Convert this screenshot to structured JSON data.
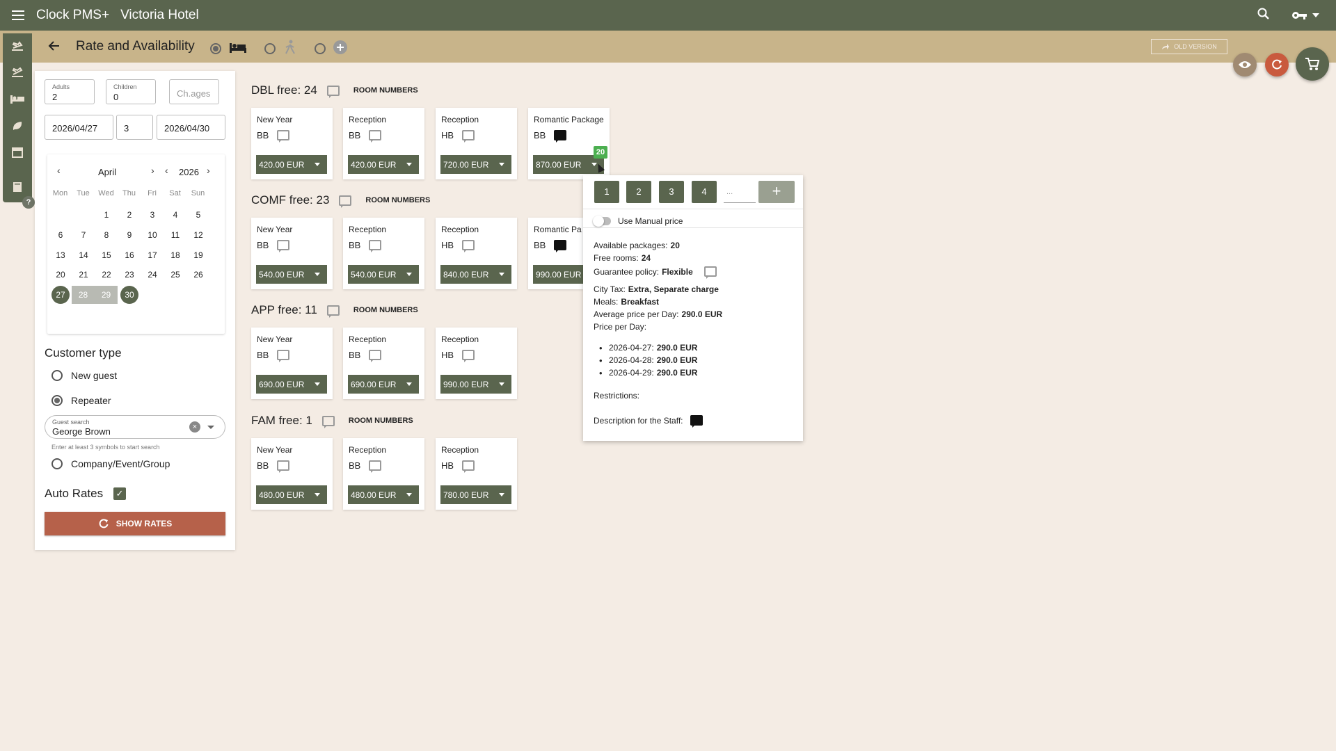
{
  "app": {
    "name": "Clock PMS+",
    "hotel": "Victoria Hotel"
  },
  "page": {
    "title": "Rate and Availability",
    "old_version": "OLD VERSION"
  },
  "icons": {
    "menu": "menu-icon",
    "search": "search-icon",
    "key": "key-icon",
    "eye": "eye-icon",
    "refresh": "refresh-icon",
    "cart": "cart-icon"
  },
  "colors": {
    "topbar": "#5a654e",
    "subbar": "#c8b48a",
    "accent": "#b6614a",
    "badge": "#4caf50"
  },
  "search": {
    "adults_label": "Adults",
    "adults": "2",
    "children_label": "Children",
    "children": "0",
    "ch_ages_placeholder": "Ch.ages",
    "date_from": "2026/04/27",
    "nights": "3",
    "date_to": "2026/04/30"
  },
  "calendar": {
    "month": "April",
    "year": "2026",
    "weekdays": [
      "Mon",
      "Tue",
      "Wed",
      "Thu",
      "Fri",
      "Sat",
      "Sun"
    ],
    "weeks": [
      [
        "",
        "",
        "1",
        "2",
        "3",
        "4",
        "5"
      ],
      [
        "6",
        "7",
        "8",
        "9",
        "10",
        "11",
        "12"
      ],
      [
        "13",
        "14",
        "15",
        "16",
        "17",
        "18",
        "19"
      ],
      [
        "20",
        "21",
        "22",
        "23",
        "24",
        "25",
        "26"
      ],
      [
        "27",
        "28",
        "29",
        "30",
        "",
        "",
        ""
      ]
    ],
    "selected": [
      "27",
      "30"
    ],
    "in_range": [
      "28",
      "29"
    ]
  },
  "customer": {
    "title": "Customer type",
    "options": [
      "New guest",
      "Repeater",
      "Company/Event/Group"
    ],
    "selected": "Repeater",
    "guest_search_label": "Guest search",
    "guest_value": "George Brown",
    "guest_hint": "Enter at least 3 symbols to start search"
  },
  "auto_rates": {
    "label": "Auto Rates",
    "checked": true
  },
  "show_rates": "SHOW RATES",
  "room_numbers_label": "ROOM NUMBERS",
  "rooms": [
    {
      "title": "DBL free: 24",
      "cards": [
        {
          "name": "New Year",
          "meal": "BB",
          "price": "420.00 EUR",
          "note": false
        },
        {
          "name": "Reception",
          "meal": "BB",
          "price": "420.00 EUR",
          "note": false
        },
        {
          "name": "Reception",
          "meal": "HB",
          "price": "720.00 EUR",
          "note": false
        },
        {
          "name": "Romantic Package",
          "meal": "BB",
          "price": "870.00 EUR",
          "note": true
        }
      ]
    },
    {
      "title": "COMF free: 23",
      "cards": [
        {
          "name": "New Year",
          "meal": "BB",
          "price": "540.00 EUR",
          "note": false
        },
        {
          "name": "Reception",
          "meal": "BB",
          "price": "540.00 EUR",
          "note": false
        },
        {
          "name": "Reception",
          "meal": "HB",
          "price": "840.00 EUR",
          "note": false
        },
        {
          "name": "Romantic Pa",
          "meal": "BB",
          "price": "990.00 EUR",
          "note": true
        }
      ]
    },
    {
      "title": "APP free: 11",
      "cards": [
        {
          "name": "New Year",
          "meal": "BB",
          "price": "690.00 EUR",
          "note": false
        },
        {
          "name": "Reception",
          "meal": "BB",
          "price": "690.00 EUR",
          "note": false
        },
        {
          "name": "Reception",
          "meal": "HB",
          "price": "990.00 EUR",
          "note": false
        }
      ]
    },
    {
      "title": "FAM free: 1",
      "cards": [
        {
          "name": "New Year",
          "meal": "BB",
          "price": "480.00 EUR",
          "note": false
        },
        {
          "name": "Reception",
          "meal": "BB",
          "price": "480.00 EUR",
          "note": false
        },
        {
          "name": "Reception",
          "meal": "HB",
          "price": "780.00 EUR",
          "note": false
        }
      ]
    }
  ],
  "badge": "20",
  "popup": {
    "quantities": [
      "1",
      "2",
      "3",
      "4"
    ],
    "qty_placeholder": "...",
    "add": "+",
    "manual_price": "Use Manual price",
    "available_label": "Available packages:",
    "available": "20",
    "free_label": "Free rooms:",
    "free": "24",
    "guarantee_label": "Guarantee policy:",
    "guarantee": "Flexible",
    "city_tax_label": "City Tax:",
    "city_tax": "Extra, Separate charge",
    "meals_label": "Meals:",
    "meals": "Breakfast",
    "avg_label": "Average price per Day:",
    "avg": "290.0 EUR",
    "per_day_label": "Price per Day:",
    "per_day": [
      {
        "date": "2026-04-27:",
        "price": "290.0 EUR"
      },
      {
        "date": "2026-04-28:",
        "price": "290.0 EUR"
      },
      {
        "date": "2026-04-29:",
        "price": "290.0 EUR"
      }
    ],
    "restrictions_label": "Restrictions:",
    "staff_label": "Description for the Staff:"
  }
}
